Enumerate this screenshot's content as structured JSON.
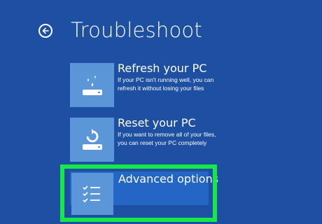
{
  "header": {
    "title": "Troubleshoot",
    "back_icon": "back-arrow-icon"
  },
  "options": [
    {
      "title": "Refresh your PC",
      "description": "If your PC isn't running well, you can refresh it without losing your files",
      "icon": "refresh-pc-icon"
    },
    {
      "title": "Reset your PC",
      "description": "If you want to remove all of your files, you can reset your PC completely",
      "icon": "reset-pc-icon"
    },
    {
      "title": "Advanced options",
      "description": "",
      "icon": "checklist-icon"
    }
  ],
  "colors": {
    "background": "#1d4fa3",
    "tile": "#5b96d9",
    "selected_bg": "#2366c5",
    "highlight": "#17e84a"
  }
}
